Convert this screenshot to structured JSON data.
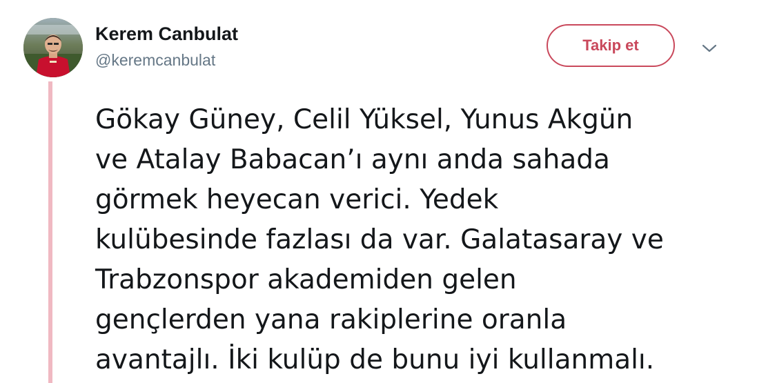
{
  "user": {
    "display_name": "Kerem Canbulat",
    "handle": "@keremcanbulat"
  },
  "actions": {
    "follow_label": "Takip et"
  },
  "icons": {
    "more": "chevron-down-icon"
  },
  "colors": {
    "accent": "#c9485b",
    "thread_line": "#f0b9c2",
    "text": "#14171a",
    "secondary_text": "#657786"
  },
  "tweet": {
    "text": "Gökay Güney, Celil Yüksel, Yunus Akgün\nve Atalay Babacan’ı aynı anda sahada\ngörmek heyecan verici. Yedek\nkulübesinde fazlası da var. Galatasaray ve\nTrabzonspor akademiden gelen\ngençlerden yana rakiplerine oranla\navantajlı. İki kulüp de bunu iyi kullanmalı."
  }
}
